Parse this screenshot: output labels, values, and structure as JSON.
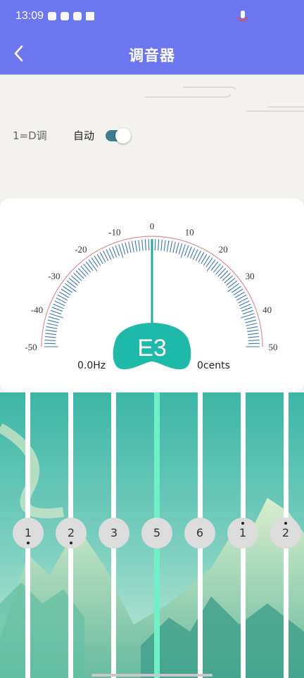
{
  "status_bar": {
    "time": "13:09",
    "icons": [
      "tiktok-icon",
      "link-icon",
      "mail-icon",
      "crown-icon"
    ],
    "mic_icon": "microphone-icon"
  },
  "header": {
    "title": "调音器",
    "back_icon": "back-arrow-icon",
    "bg_color": "#6b76ef"
  },
  "settings": {
    "key_label": "1=D调",
    "auto_label": "自动",
    "auto_enabled": true
  },
  "tuner": {
    "scale_labels_left": [
      "-50",
      "-40",
      "-30",
      "-20",
      "-10"
    ],
    "zero_label": "0",
    "scale_labels_right": [
      "10",
      "20",
      "30",
      "40",
      "50"
    ],
    "note": "E3",
    "frequency": "0.0Hz",
    "cents": "0cents",
    "needle_value": 0,
    "accent_color": "#1eb9a8"
  },
  "strings": {
    "notes": [
      {
        "label": "1",
        "dot": "below"
      },
      {
        "label": "2",
        "dot": "below"
      },
      {
        "label": "3",
        "dot": "none"
      },
      {
        "label": "5",
        "dot": "none"
      },
      {
        "label": "6",
        "dot": "none"
      },
      {
        "label": "1",
        "dot": "above"
      },
      {
        "label": "2",
        "dot": "above"
      }
    ],
    "active_index": 3
  }
}
